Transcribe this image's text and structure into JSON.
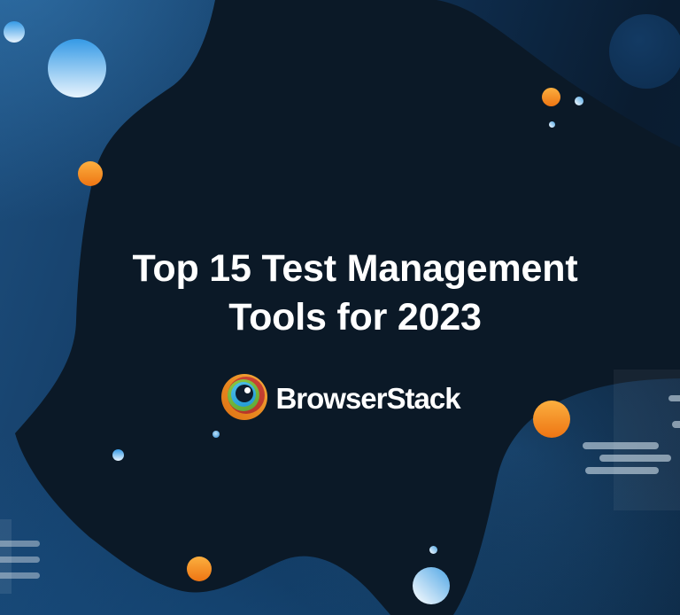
{
  "banner": {
    "title_line1": "Top 15 Test Management",
    "title_line2": "Tools for 2023",
    "brand": "BrowserStack"
  },
  "colors": {
    "background_top_left": "#1D4D7B",
    "background_dark": "#0A1C30",
    "background_bottom_right": "#12426B",
    "blob": "#0B1927",
    "orange_accent": "#F59E2C",
    "blue_accent": "#359AE6",
    "light_blue": "#E8F4FD",
    "navy_circle": "#113457",
    "text": "#FFFFFF",
    "logo_outer_orange": "#E8871F",
    "logo_red": "#C03A2E",
    "logo_green": "#6FB745",
    "logo_blue": "#2BA9E0",
    "logo_pupil": "#0D1C2C"
  },
  "icons": {
    "logo": "browserstack-eye-icon"
  }
}
